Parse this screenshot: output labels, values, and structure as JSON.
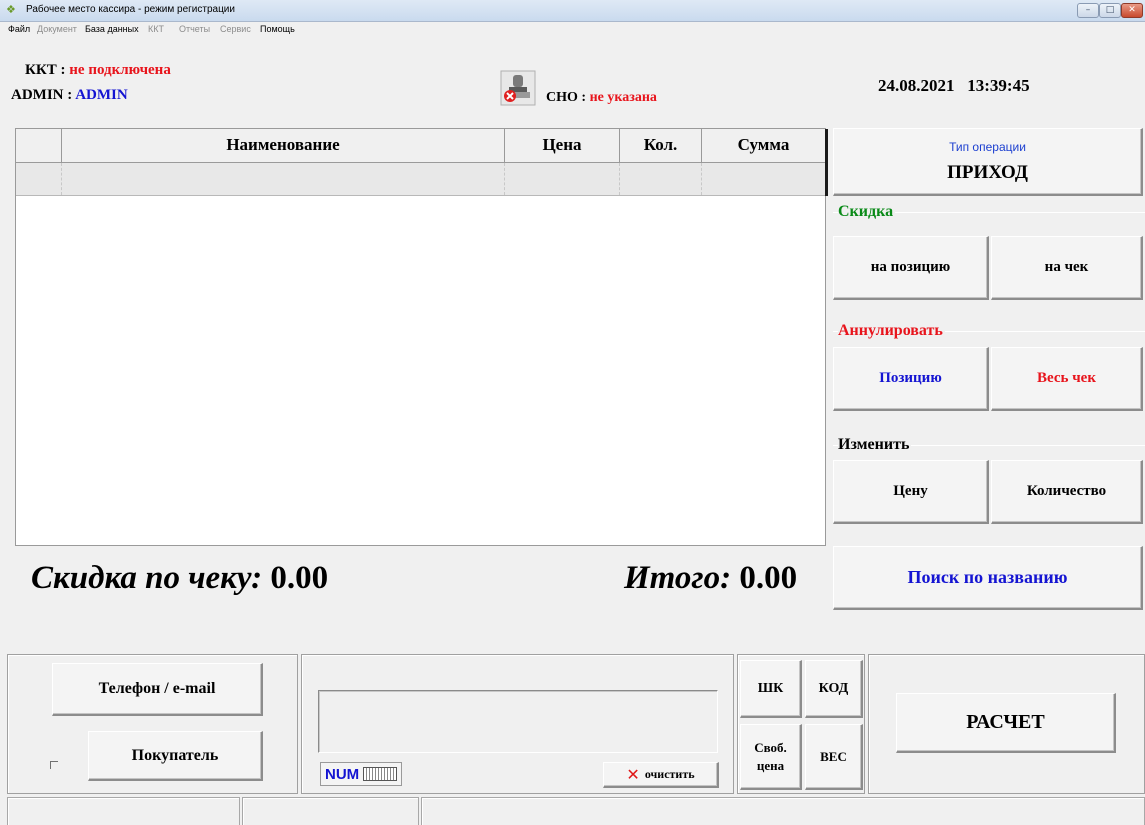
{
  "window": {
    "title": "Рабочее место кассира - режим регистрации",
    "minimize_glyph": "–",
    "maximize_glyph": "□",
    "close_glyph": "✕"
  },
  "menu": {
    "items": [
      {
        "label": "Файл",
        "enabled": true
      },
      {
        "label": "Документ",
        "enabled": false
      },
      {
        "label": "База данных",
        "enabled": true
      },
      {
        "label": "ККТ",
        "enabled": false
      },
      {
        "label": "Отчеты",
        "enabled": false
      },
      {
        "label": "Сервис",
        "enabled": false
      },
      {
        "label": "Помощь",
        "enabled": true
      }
    ]
  },
  "header": {
    "kkt_label": "ККТ :",
    "kkt_status": "не подключена",
    "user_label": "ADMIN :",
    "user_value": "ADMIN",
    "sno_label": "СНО :",
    "sno_value": "не указана",
    "date": "24.08.2021",
    "time": "13:39:45"
  },
  "table": {
    "columns": [
      "",
      "Наименование",
      "Цена",
      "Кол.",
      "Сумма"
    ],
    "rows": [
      [
        "",
        "",
        "",
        "",
        ""
      ]
    ]
  },
  "totals": {
    "discount_label": "Скидка по чеку:",
    "discount_value": "0.00",
    "total_label": "Итого:",
    "total_value": "0.00"
  },
  "operation": {
    "caption": "Тип операции",
    "type": "ПРИХОД"
  },
  "discount_group": {
    "label": "Скидка",
    "item_button": "на позицию",
    "receipt_button": "на чек"
  },
  "cancel_group": {
    "label": "Аннулировать",
    "item_button": "Позицию",
    "receipt_button": "Весь чек"
  },
  "change_group": {
    "label": "Изменить",
    "price_button": "Цену",
    "quantity_button": "Количество"
  },
  "search_button": "Поиск по названию",
  "customer": {
    "phone_button": "Телефон / e-mail",
    "buyer_button": "Покупатель",
    "buyer_checked": false
  },
  "input": {
    "value": "",
    "num_label": "NUM",
    "clear_label": "очистить"
  },
  "mode_buttons": {
    "barcode": "ШК",
    "code": "КОД",
    "free_price_line1": "Своб.",
    "free_price_line2": "цена",
    "weight": "ВЕС"
  },
  "pay_button": "РАСЧЕТ",
  "status_bar": [
    "",
    "",
    ""
  ],
  "colors": {
    "error": "#e8141c",
    "link": "#1414d2",
    "group_ok": "#0a8a18",
    "operation_caption": "#1c3fd0"
  }
}
